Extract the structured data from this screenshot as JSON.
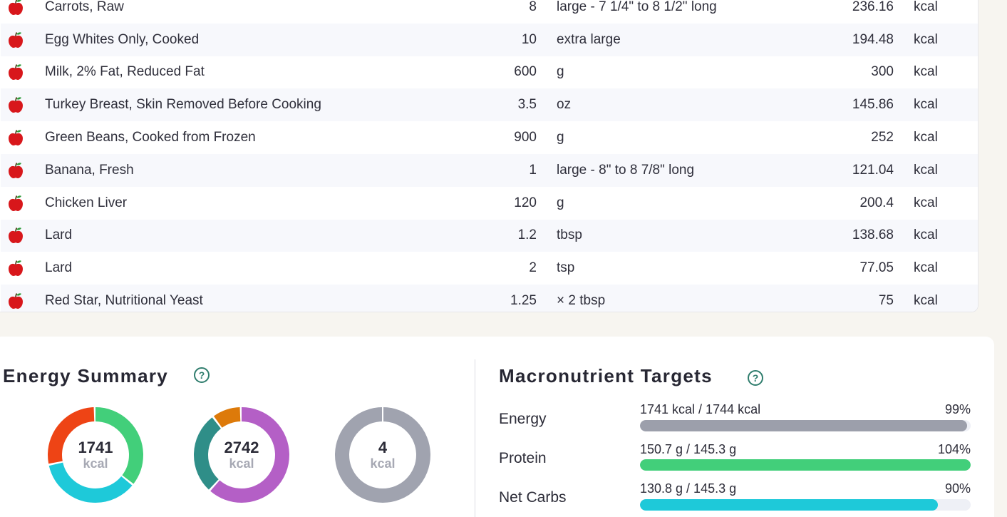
{
  "foods": [
    {
      "name": "Carrots, Raw",
      "amount": "8",
      "unit": "large - 7 1/4\" to 8 1/2\" long",
      "calories": "236.16",
      "cal_unit": "kcal"
    },
    {
      "name": "Egg Whites Only, Cooked",
      "amount": "10",
      "unit": "extra large",
      "calories": "194.48",
      "cal_unit": "kcal"
    },
    {
      "name": "Milk, 2% Fat, Reduced Fat",
      "amount": "600",
      "unit": "g",
      "calories": "300",
      "cal_unit": "kcal"
    },
    {
      "name": "Turkey Breast, Skin Removed Before Cooking",
      "amount": "3.5",
      "unit": "oz",
      "calories": "145.86",
      "cal_unit": "kcal"
    },
    {
      "name": "Green Beans, Cooked from Frozen",
      "amount": "900",
      "unit": "g",
      "calories": "252",
      "cal_unit": "kcal"
    },
    {
      "name": "Banana, Fresh",
      "amount": "1",
      "unit": "large - 8\" to 8 7/8\" long",
      "calories": "121.04",
      "cal_unit": "kcal"
    },
    {
      "name": "Chicken Liver",
      "amount": "120",
      "unit": "g",
      "calories": "200.4",
      "cal_unit": "kcal"
    },
    {
      "name": "Lard",
      "amount": "1.2",
      "unit": "tbsp",
      "calories": "138.68",
      "cal_unit": "kcal"
    },
    {
      "name": "Lard",
      "amount": "2",
      "unit": "tsp",
      "calories": "77.05",
      "cal_unit": "kcal"
    },
    {
      "name": "Red Star, Nutritional Yeast",
      "amount": "1.25",
      "unit": "× 2 tbsp",
      "calories": "75",
      "cal_unit": "kcal"
    }
  ],
  "food_icon": "apple-icon",
  "energy_summary": {
    "title": "Energy Summary",
    "help_icon": "?",
    "donuts": [
      {
        "value": "1741",
        "unit": "kcal",
        "segments": [
          {
            "color": "#42cf7a",
            "fraction": 0.36
          },
          {
            "color": "#1ec9d9",
            "fraction": 0.36
          },
          {
            "color": "#ee4415",
            "fraction": 0.28
          }
        ]
      },
      {
        "value": "2742",
        "unit": "kcal",
        "segments": [
          {
            "color": "#b45fc6",
            "fraction": 0.62
          },
          {
            "color": "#2f8e88",
            "fraction": 0.28
          },
          {
            "color": "#dd7a0a",
            "fraction": 0.1
          }
        ]
      },
      {
        "value": "4",
        "unit": "kcal",
        "segments": [
          {
            "color": "#a0a3af",
            "fraction": 1.0
          }
        ]
      }
    ]
  },
  "macro_targets": {
    "title": "Macronutrient Targets",
    "help_icon": "?",
    "items": [
      {
        "label": "Energy",
        "text": "1741 kcal / 1744 kcal",
        "percent": "99%",
        "fill_fraction": 0.99,
        "color": "#9c9fab"
      },
      {
        "label": "Protein",
        "text": "150.7 g / 145.3 g",
        "percent": "104%",
        "fill_fraction": 1.0,
        "color": "#42cf7a"
      },
      {
        "label": "Net Carbs",
        "text": "130.8 g / 145.3 g",
        "percent": "90%",
        "fill_fraction": 0.9,
        "color": "#1ec9d9"
      }
    ]
  }
}
